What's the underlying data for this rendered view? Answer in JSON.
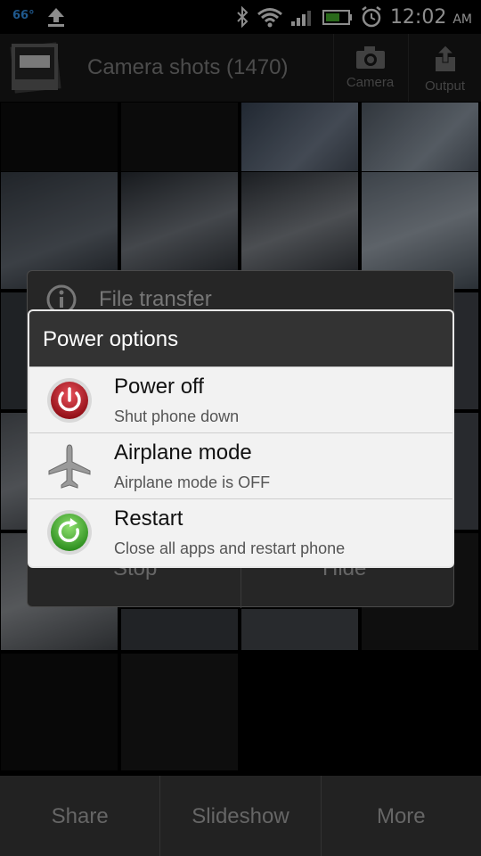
{
  "status_bar": {
    "temperature": "66°",
    "time": "12:02",
    "ampm": "AM"
  },
  "app_bar": {
    "title": "Camera shots (1470)",
    "camera_label": "Camera",
    "output_label": "Output"
  },
  "background_dialog": {
    "title": "File transfer",
    "stop_label": "Stop",
    "hide_label": "Hide"
  },
  "power_dialog": {
    "title": "Power options",
    "items": [
      {
        "label": "Power off",
        "sub": "Shut phone down",
        "icon": "power-icon"
      },
      {
        "label": "Airplane mode",
        "sub": "Airplane mode is OFF",
        "icon": "airplane-icon"
      },
      {
        "label": "Restart",
        "sub": "Close all apps and restart phone",
        "icon": "restart-icon"
      }
    ]
  },
  "bottom_bar": {
    "share_label": "Share",
    "slideshow_label": "Slideshow",
    "more_label": "More"
  },
  "colors": {
    "accent_blue": "#39a0ff",
    "power_red": "#c0141e",
    "restart_green": "#39b02a"
  }
}
